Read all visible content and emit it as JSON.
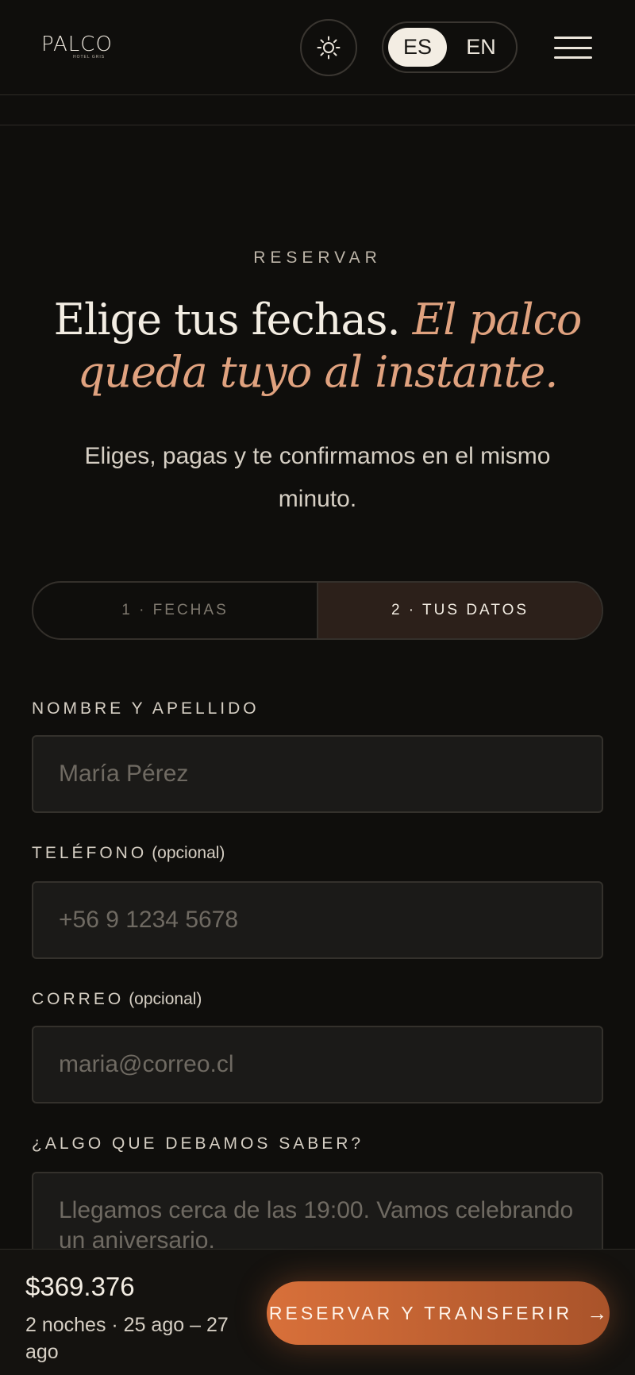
{
  "header": {
    "logo": "PALCO",
    "logo_sub": "HOTEL GRIS",
    "lang_active": "ES",
    "lang_other": "EN",
    "theme_icon": "sun-icon",
    "menu_icon": "hamburger-icon"
  },
  "hero": {
    "eyebrow": "RESERVAR",
    "headline_plain": "Elige tus fechas. ",
    "headline_accent": "El palco queda tuyo al instante.",
    "subtitle": "Eliges, pagas y te confirmamos en el mismo minuto."
  },
  "steps": [
    {
      "label": "1 · FECHAS",
      "state": "done"
    },
    {
      "label": "2 · TUS DATOS",
      "state": "active"
    }
  ],
  "form": {
    "name_label": "NOMBRE Y APELLIDO",
    "name_placeholder": "María Pérez",
    "phone_label": "TELÉFONO",
    "phone_optional": "(opcional)",
    "phone_placeholder": "+56 9 1234 5678",
    "email_label": "CORREO",
    "email_optional": "(opcional)",
    "email_placeholder": "maria@correo.cl",
    "notes_label": "¿ALGO QUE DEBAMOS SABER?",
    "notes_placeholder": "Llegamos cerca de las 19:00. Vamos celebrando un aniversario."
  },
  "summary": {
    "price": "$369.376",
    "stay": "2 noches · 25 ago – 27 ago",
    "cta_label": "RESERVAR Y TRANSFERIR",
    "cta_icon": "arrow-right-icon"
  },
  "colors": {
    "background": "#0f0e0c",
    "accent": "#e0a27f",
    "cta": "#d8703a"
  }
}
